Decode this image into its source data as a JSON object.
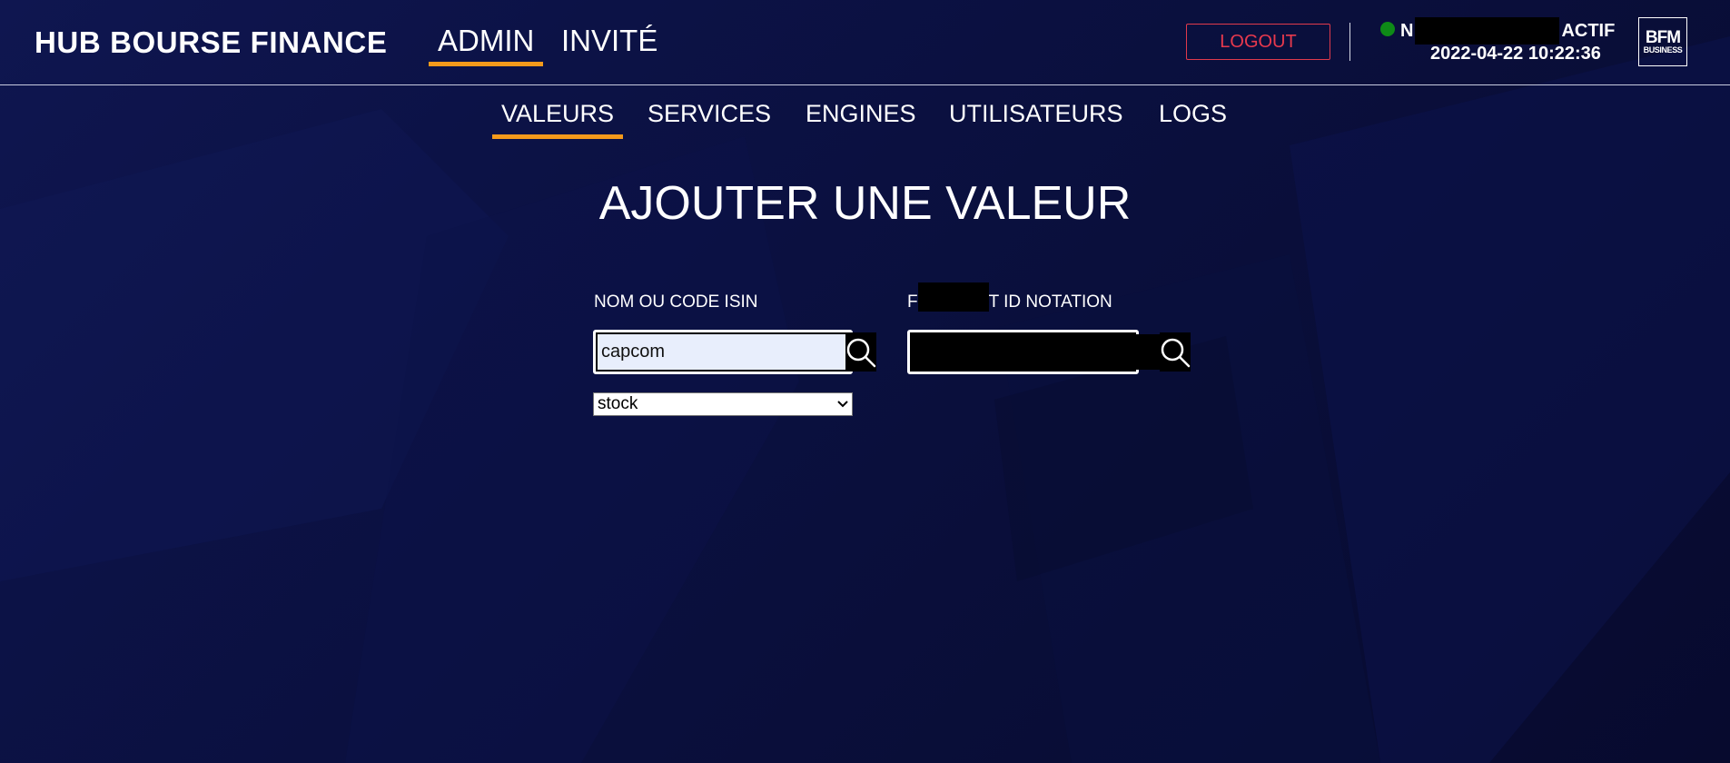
{
  "header": {
    "brand": "HUB BOURSE FINANCE",
    "tabs": [
      {
        "label": "ADMIN",
        "active": true
      },
      {
        "label": "INVITÉ",
        "active": false
      }
    ],
    "logout_label": "LOGOUT",
    "user": {
      "prefix": "N",
      "status": "ACTIF",
      "status_color": "#0e8a17",
      "datetime": "2022-04-22 10:22:36"
    },
    "logo": {
      "line1": "BFM",
      "line2": "BUSINESS"
    }
  },
  "subnav": [
    {
      "label": "VALEURS",
      "active": true
    },
    {
      "label": "SERVICES",
      "active": false
    },
    {
      "label": "ENGINES",
      "active": false
    },
    {
      "label": "UTILISATEURS",
      "active": false
    },
    {
      "label": "LOGS",
      "active": false
    }
  ],
  "main": {
    "title": "AJOUTER UNE VALEUR",
    "isin_field": {
      "label": "NOM OU CODE ISIN",
      "value": "capcom",
      "search_icon": "search-icon"
    },
    "notation_field": {
      "label_prefix": "F",
      "label_suffix": "T ID NOTATION",
      "value": "",
      "search_icon": "search-icon"
    },
    "type_select": {
      "value": "stock"
    }
  },
  "colors": {
    "accent": "#f59a1b",
    "logout": "#e8394d",
    "background": "#0c1246"
  }
}
